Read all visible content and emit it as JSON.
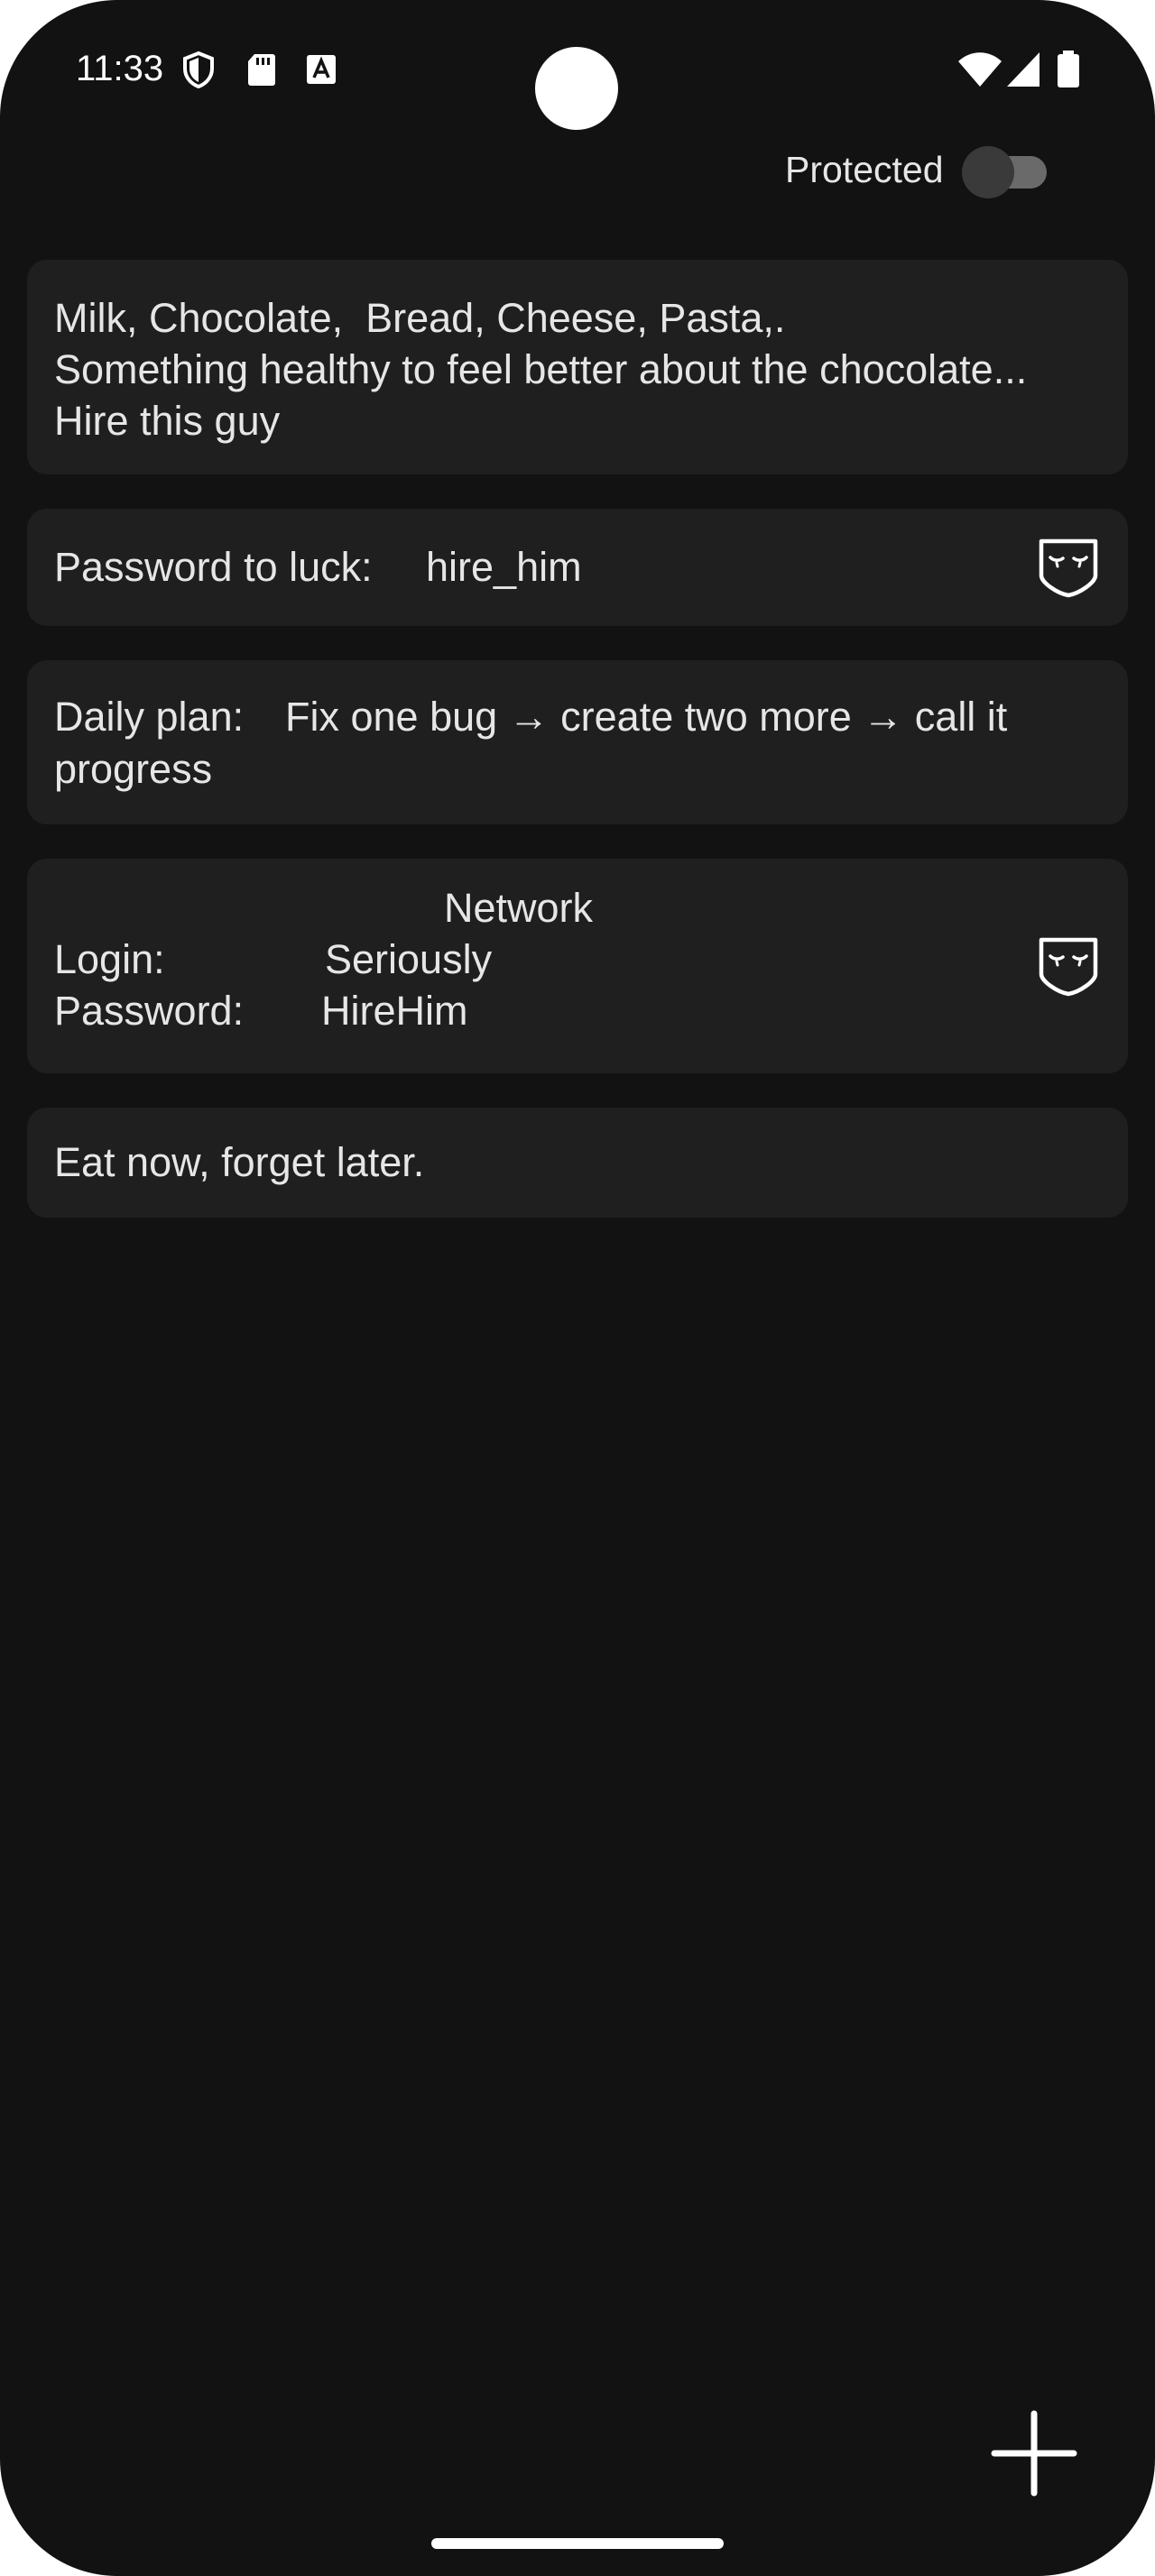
{
  "status_bar": {
    "time": "11:33",
    "icons_left": [
      "vpn-shield-icon",
      "sd-card-icon",
      "keyboard-a-icon"
    ],
    "icons_right": [
      "wifi-icon",
      "cellular-signal-icon",
      "battery-icon"
    ]
  },
  "header": {
    "protected_label": "Protected",
    "protected_toggle_on": false
  },
  "notes": [
    {
      "lines": [
        "Milk, Chocolate,  Bread, Cheese, Pasta,.",
        "Something healthy to feel better about the chocolate...",
        "Hire this guy"
      ],
      "protected": false
    },
    {
      "label": "Password to luck:",
      "value": "hire_him",
      "protected": true,
      "icon": "mask-icon"
    },
    {
      "label": "Daily plan:",
      "line1": "Fix one bug → create two more → call it",
      "line2": "progress",
      "protected": false
    },
    {
      "title": "Network",
      "login_label": "Login:",
      "login_value": "Seriously",
      "password_label": "Password:",
      "password_value": "HireHim",
      "protected": true,
      "icon": "mask-icon"
    },
    {
      "text": "Eat now, forget later.",
      "protected": false
    }
  ],
  "fab": {
    "icon": "plus-icon"
  },
  "colors": {
    "background": "#121212",
    "card": "#1f1f1f",
    "text": "#e6e6e6",
    "accent": "#ffffff"
  }
}
